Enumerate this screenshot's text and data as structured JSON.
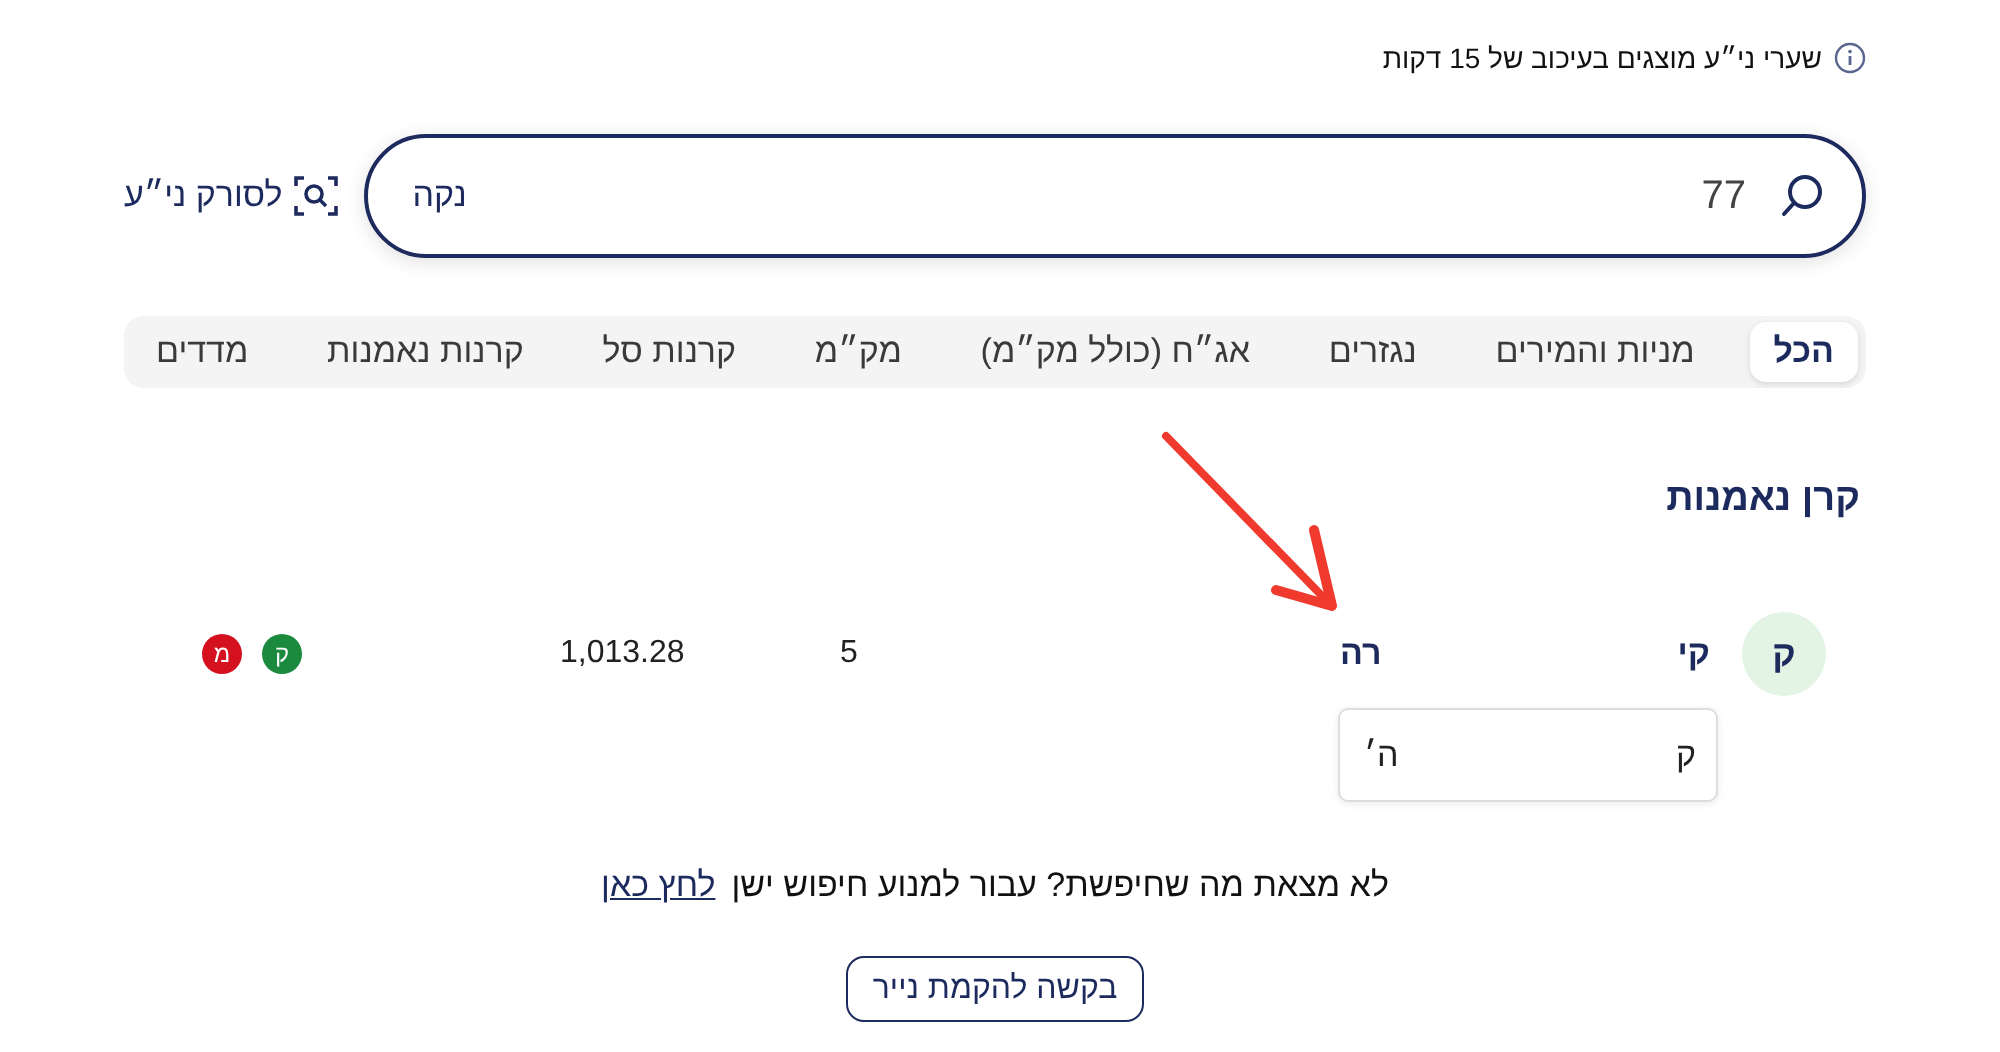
{
  "notice": {
    "text": "שערי ני״ע מוצגים בעיכוב של 15 דקות"
  },
  "search": {
    "value": "77",
    "clear": "נקה"
  },
  "scanner": {
    "label": "לסורק ני״ע"
  },
  "tabs": [
    {
      "label": "הכל",
      "selected": true
    },
    {
      "label": "מניות והמירים",
      "selected": false
    },
    {
      "label": "נגזרים",
      "selected": false
    },
    {
      "label": "אג״ח (כולל מק״מ)",
      "selected": false
    },
    {
      "label": "מק״מ",
      "selected": false
    },
    {
      "label": "קרנות סל",
      "selected": false
    },
    {
      "label": "קרנות נאמנות",
      "selected": false
    },
    {
      "label": "מדדים",
      "selected": false
    }
  ],
  "section": {
    "title": "קרן נאמנות"
  },
  "results": [
    {
      "avatar": "ק",
      "name_start": "קי",
      "name_end": "רה",
      "column_3": "5",
      "column_4": "1,013.28",
      "badges": [
        {
          "label": "ק",
          "color": "#1b8a3e"
        },
        {
          "label": "מ",
          "color": "#d5101f"
        }
      ],
      "tooltip": {
        "text_start": "ק",
        "text_end": "ה׳"
      }
    }
  ],
  "footer": {
    "text": "לא מצאת מה שחיפשת? עבור למנוע חיפוש ישן",
    "link": "לחץ כאן"
  },
  "request_button": {
    "label": "בקשה להקמת נייר"
  }
}
